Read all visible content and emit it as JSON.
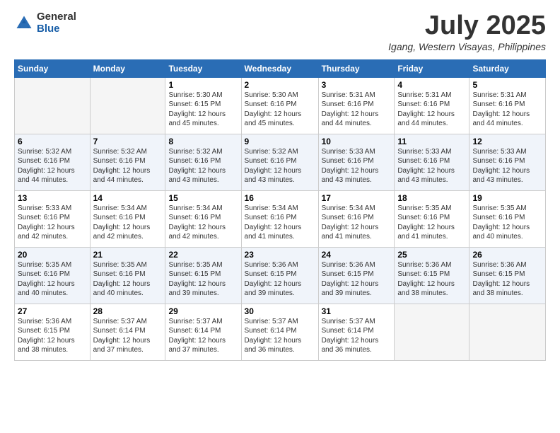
{
  "logo": {
    "general": "General",
    "blue": "Blue"
  },
  "title": {
    "month": "July 2025",
    "location": "Igang, Western Visayas, Philippines"
  },
  "days_of_week": [
    "Sunday",
    "Monday",
    "Tuesday",
    "Wednesday",
    "Thursday",
    "Friday",
    "Saturday"
  ],
  "weeks": [
    [
      {
        "day": null
      },
      {
        "day": null
      },
      {
        "day": 1,
        "sunrise": "Sunrise: 5:30 AM",
        "sunset": "Sunset: 6:15 PM",
        "daylight": "Daylight: 12 hours and 45 minutes."
      },
      {
        "day": 2,
        "sunrise": "Sunrise: 5:30 AM",
        "sunset": "Sunset: 6:16 PM",
        "daylight": "Daylight: 12 hours and 45 minutes."
      },
      {
        "day": 3,
        "sunrise": "Sunrise: 5:31 AM",
        "sunset": "Sunset: 6:16 PM",
        "daylight": "Daylight: 12 hours and 44 minutes."
      },
      {
        "day": 4,
        "sunrise": "Sunrise: 5:31 AM",
        "sunset": "Sunset: 6:16 PM",
        "daylight": "Daylight: 12 hours and 44 minutes."
      },
      {
        "day": 5,
        "sunrise": "Sunrise: 5:31 AM",
        "sunset": "Sunset: 6:16 PM",
        "daylight": "Daylight: 12 hours and 44 minutes."
      }
    ],
    [
      {
        "day": 6,
        "sunrise": "Sunrise: 5:32 AM",
        "sunset": "Sunset: 6:16 PM",
        "daylight": "Daylight: 12 hours and 44 minutes."
      },
      {
        "day": 7,
        "sunrise": "Sunrise: 5:32 AM",
        "sunset": "Sunset: 6:16 PM",
        "daylight": "Daylight: 12 hours and 44 minutes."
      },
      {
        "day": 8,
        "sunrise": "Sunrise: 5:32 AM",
        "sunset": "Sunset: 6:16 PM",
        "daylight": "Daylight: 12 hours and 43 minutes."
      },
      {
        "day": 9,
        "sunrise": "Sunrise: 5:32 AM",
        "sunset": "Sunset: 6:16 PM",
        "daylight": "Daylight: 12 hours and 43 minutes."
      },
      {
        "day": 10,
        "sunrise": "Sunrise: 5:33 AM",
        "sunset": "Sunset: 6:16 PM",
        "daylight": "Daylight: 12 hours and 43 minutes."
      },
      {
        "day": 11,
        "sunrise": "Sunrise: 5:33 AM",
        "sunset": "Sunset: 6:16 PM",
        "daylight": "Daylight: 12 hours and 43 minutes."
      },
      {
        "day": 12,
        "sunrise": "Sunrise: 5:33 AM",
        "sunset": "Sunset: 6:16 PM",
        "daylight": "Daylight: 12 hours and 43 minutes."
      }
    ],
    [
      {
        "day": 13,
        "sunrise": "Sunrise: 5:33 AM",
        "sunset": "Sunset: 6:16 PM",
        "daylight": "Daylight: 12 hours and 42 minutes."
      },
      {
        "day": 14,
        "sunrise": "Sunrise: 5:34 AM",
        "sunset": "Sunset: 6:16 PM",
        "daylight": "Daylight: 12 hours and 42 minutes."
      },
      {
        "day": 15,
        "sunrise": "Sunrise: 5:34 AM",
        "sunset": "Sunset: 6:16 PM",
        "daylight": "Daylight: 12 hours and 42 minutes."
      },
      {
        "day": 16,
        "sunrise": "Sunrise: 5:34 AM",
        "sunset": "Sunset: 6:16 PM",
        "daylight": "Daylight: 12 hours and 41 minutes."
      },
      {
        "day": 17,
        "sunrise": "Sunrise: 5:34 AM",
        "sunset": "Sunset: 6:16 PM",
        "daylight": "Daylight: 12 hours and 41 minutes."
      },
      {
        "day": 18,
        "sunrise": "Sunrise: 5:35 AM",
        "sunset": "Sunset: 6:16 PM",
        "daylight": "Daylight: 12 hours and 41 minutes."
      },
      {
        "day": 19,
        "sunrise": "Sunrise: 5:35 AM",
        "sunset": "Sunset: 6:16 PM",
        "daylight": "Daylight: 12 hours and 40 minutes."
      }
    ],
    [
      {
        "day": 20,
        "sunrise": "Sunrise: 5:35 AM",
        "sunset": "Sunset: 6:16 PM",
        "daylight": "Daylight: 12 hours and 40 minutes."
      },
      {
        "day": 21,
        "sunrise": "Sunrise: 5:35 AM",
        "sunset": "Sunset: 6:16 PM",
        "daylight": "Daylight: 12 hours and 40 minutes."
      },
      {
        "day": 22,
        "sunrise": "Sunrise: 5:35 AM",
        "sunset": "Sunset: 6:15 PM",
        "daylight": "Daylight: 12 hours and 39 minutes."
      },
      {
        "day": 23,
        "sunrise": "Sunrise: 5:36 AM",
        "sunset": "Sunset: 6:15 PM",
        "daylight": "Daylight: 12 hours and 39 minutes."
      },
      {
        "day": 24,
        "sunrise": "Sunrise: 5:36 AM",
        "sunset": "Sunset: 6:15 PM",
        "daylight": "Daylight: 12 hours and 39 minutes."
      },
      {
        "day": 25,
        "sunrise": "Sunrise: 5:36 AM",
        "sunset": "Sunset: 6:15 PM",
        "daylight": "Daylight: 12 hours and 38 minutes."
      },
      {
        "day": 26,
        "sunrise": "Sunrise: 5:36 AM",
        "sunset": "Sunset: 6:15 PM",
        "daylight": "Daylight: 12 hours and 38 minutes."
      }
    ],
    [
      {
        "day": 27,
        "sunrise": "Sunrise: 5:36 AM",
        "sunset": "Sunset: 6:15 PM",
        "daylight": "Daylight: 12 hours and 38 minutes."
      },
      {
        "day": 28,
        "sunrise": "Sunrise: 5:37 AM",
        "sunset": "Sunset: 6:14 PM",
        "daylight": "Daylight: 12 hours and 37 minutes."
      },
      {
        "day": 29,
        "sunrise": "Sunrise: 5:37 AM",
        "sunset": "Sunset: 6:14 PM",
        "daylight": "Daylight: 12 hours and 37 minutes."
      },
      {
        "day": 30,
        "sunrise": "Sunrise: 5:37 AM",
        "sunset": "Sunset: 6:14 PM",
        "daylight": "Daylight: 12 hours and 36 minutes."
      },
      {
        "day": 31,
        "sunrise": "Sunrise: 5:37 AM",
        "sunset": "Sunset: 6:14 PM",
        "daylight": "Daylight: 12 hours and 36 minutes."
      },
      {
        "day": null
      },
      {
        "day": null
      }
    ]
  ]
}
